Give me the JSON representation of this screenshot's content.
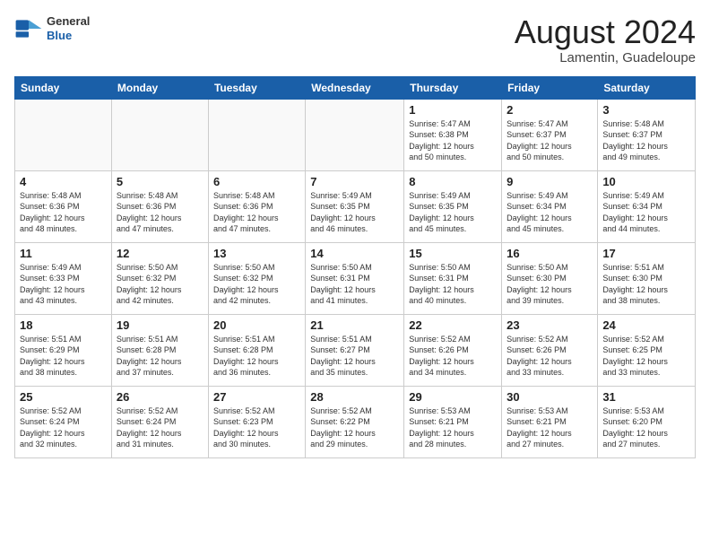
{
  "header": {
    "logo_general": "General",
    "logo_blue": "Blue",
    "month_year": "August 2024",
    "location": "Lamentin, Guadeloupe"
  },
  "days_of_week": [
    "Sunday",
    "Monday",
    "Tuesday",
    "Wednesday",
    "Thursday",
    "Friday",
    "Saturday"
  ],
  "weeks": [
    [
      {
        "day": "",
        "info": ""
      },
      {
        "day": "",
        "info": ""
      },
      {
        "day": "",
        "info": ""
      },
      {
        "day": "",
        "info": ""
      },
      {
        "day": "1",
        "info": "Sunrise: 5:47 AM\nSunset: 6:38 PM\nDaylight: 12 hours\nand 50 minutes."
      },
      {
        "day": "2",
        "info": "Sunrise: 5:47 AM\nSunset: 6:37 PM\nDaylight: 12 hours\nand 50 minutes."
      },
      {
        "day": "3",
        "info": "Sunrise: 5:48 AM\nSunset: 6:37 PM\nDaylight: 12 hours\nand 49 minutes."
      }
    ],
    [
      {
        "day": "4",
        "info": "Sunrise: 5:48 AM\nSunset: 6:36 PM\nDaylight: 12 hours\nand 48 minutes."
      },
      {
        "day": "5",
        "info": "Sunrise: 5:48 AM\nSunset: 6:36 PM\nDaylight: 12 hours\nand 47 minutes."
      },
      {
        "day": "6",
        "info": "Sunrise: 5:48 AM\nSunset: 6:36 PM\nDaylight: 12 hours\nand 47 minutes."
      },
      {
        "day": "7",
        "info": "Sunrise: 5:49 AM\nSunset: 6:35 PM\nDaylight: 12 hours\nand 46 minutes."
      },
      {
        "day": "8",
        "info": "Sunrise: 5:49 AM\nSunset: 6:35 PM\nDaylight: 12 hours\nand 45 minutes."
      },
      {
        "day": "9",
        "info": "Sunrise: 5:49 AM\nSunset: 6:34 PM\nDaylight: 12 hours\nand 45 minutes."
      },
      {
        "day": "10",
        "info": "Sunrise: 5:49 AM\nSunset: 6:34 PM\nDaylight: 12 hours\nand 44 minutes."
      }
    ],
    [
      {
        "day": "11",
        "info": "Sunrise: 5:49 AM\nSunset: 6:33 PM\nDaylight: 12 hours\nand 43 minutes."
      },
      {
        "day": "12",
        "info": "Sunrise: 5:50 AM\nSunset: 6:32 PM\nDaylight: 12 hours\nand 42 minutes."
      },
      {
        "day": "13",
        "info": "Sunrise: 5:50 AM\nSunset: 6:32 PM\nDaylight: 12 hours\nand 42 minutes."
      },
      {
        "day": "14",
        "info": "Sunrise: 5:50 AM\nSunset: 6:31 PM\nDaylight: 12 hours\nand 41 minutes."
      },
      {
        "day": "15",
        "info": "Sunrise: 5:50 AM\nSunset: 6:31 PM\nDaylight: 12 hours\nand 40 minutes."
      },
      {
        "day": "16",
        "info": "Sunrise: 5:50 AM\nSunset: 6:30 PM\nDaylight: 12 hours\nand 39 minutes."
      },
      {
        "day": "17",
        "info": "Sunrise: 5:51 AM\nSunset: 6:30 PM\nDaylight: 12 hours\nand 38 minutes."
      }
    ],
    [
      {
        "day": "18",
        "info": "Sunrise: 5:51 AM\nSunset: 6:29 PM\nDaylight: 12 hours\nand 38 minutes."
      },
      {
        "day": "19",
        "info": "Sunrise: 5:51 AM\nSunset: 6:28 PM\nDaylight: 12 hours\nand 37 minutes."
      },
      {
        "day": "20",
        "info": "Sunrise: 5:51 AM\nSunset: 6:28 PM\nDaylight: 12 hours\nand 36 minutes."
      },
      {
        "day": "21",
        "info": "Sunrise: 5:51 AM\nSunset: 6:27 PM\nDaylight: 12 hours\nand 35 minutes."
      },
      {
        "day": "22",
        "info": "Sunrise: 5:52 AM\nSunset: 6:26 PM\nDaylight: 12 hours\nand 34 minutes."
      },
      {
        "day": "23",
        "info": "Sunrise: 5:52 AM\nSunset: 6:26 PM\nDaylight: 12 hours\nand 33 minutes."
      },
      {
        "day": "24",
        "info": "Sunrise: 5:52 AM\nSunset: 6:25 PM\nDaylight: 12 hours\nand 33 minutes."
      }
    ],
    [
      {
        "day": "25",
        "info": "Sunrise: 5:52 AM\nSunset: 6:24 PM\nDaylight: 12 hours\nand 32 minutes."
      },
      {
        "day": "26",
        "info": "Sunrise: 5:52 AM\nSunset: 6:24 PM\nDaylight: 12 hours\nand 31 minutes."
      },
      {
        "day": "27",
        "info": "Sunrise: 5:52 AM\nSunset: 6:23 PM\nDaylight: 12 hours\nand 30 minutes."
      },
      {
        "day": "28",
        "info": "Sunrise: 5:52 AM\nSunset: 6:22 PM\nDaylight: 12 hours\nand 29 minutes."
      },
      {
        "day": "29",
        "info": "Sunrise: 5:53 AM\nSunset: 6:21 PM\nDaylight: 12 hours\nand 28 minutes."
      },
      {
        "day": "30",
        "info": "Sunrise: 5:53 AM\nSunset: 6:21 PM\nDaylight: 12 hours\nand 27 minutes."
      },
      {
        "day": "31",
        "info": "Sunrise: 5:53 AM\nSunset: 6:20 PM\nDaylight: 12 hours\nand 27 minutes."
      }
    ]
  ]
}
